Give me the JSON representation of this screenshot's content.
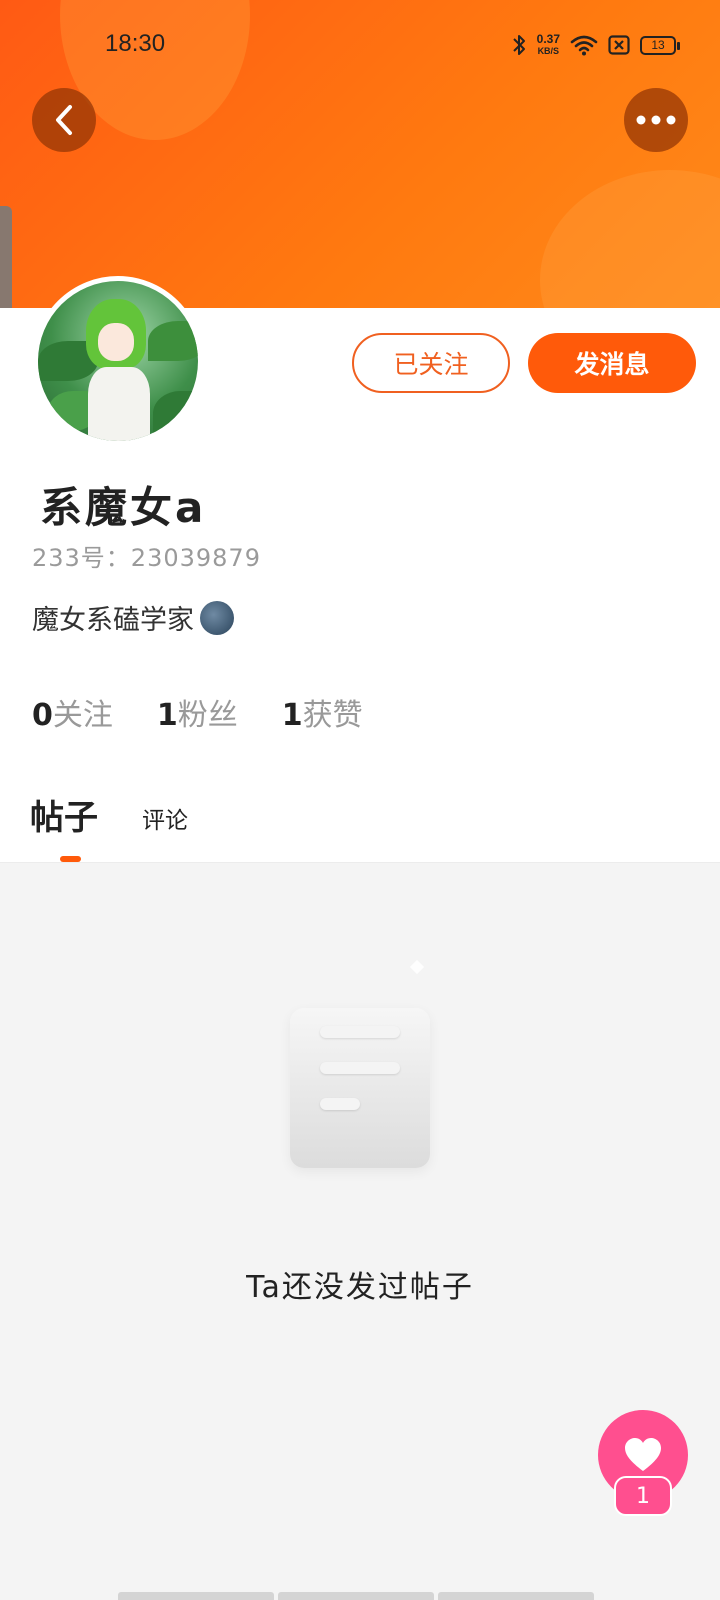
{
  "status_bar": {
    "time": "18:30",
    "speed_value": "0.37",
    "speed_unit": "KB/S",
    "battery": "13"
  },
  "header": {
    "back_icon": "chevron-left-icon",
    "more_icon": "more-horizontal-icon",
    "colors": {
      "gradient_start": "#ff5a14",
      "gradient_end": "#ff8a1a"
    }
  },
  "profile": {
    "follow_button_label": "已关注",
    "message_button_label": "发消息",
    "username": "系魔女a",
    "user_id": "233号：23039879",
    "bio": "魔女系磕学家",
    "stats": [
      {
        "num": "0",
        "label": "关注"
      },
      {
        "num": "1",
        "label": "粉丝"
      },
      {
        "num": "1",
        "label": "获赞"
      }
    ]
  },
  "tabs": {
    "posts": "帖子",
    "comments": "评论",
    "active": "posts"
  },
  "empty_state": {
    "text": "Ta还没发过帖子"
  },
  "like": {
    "count": "1",
    "icon": "heart-icon",
    "color": "#ff4f8f"
  },
  "accent_color": "#ff5a0a"
}
